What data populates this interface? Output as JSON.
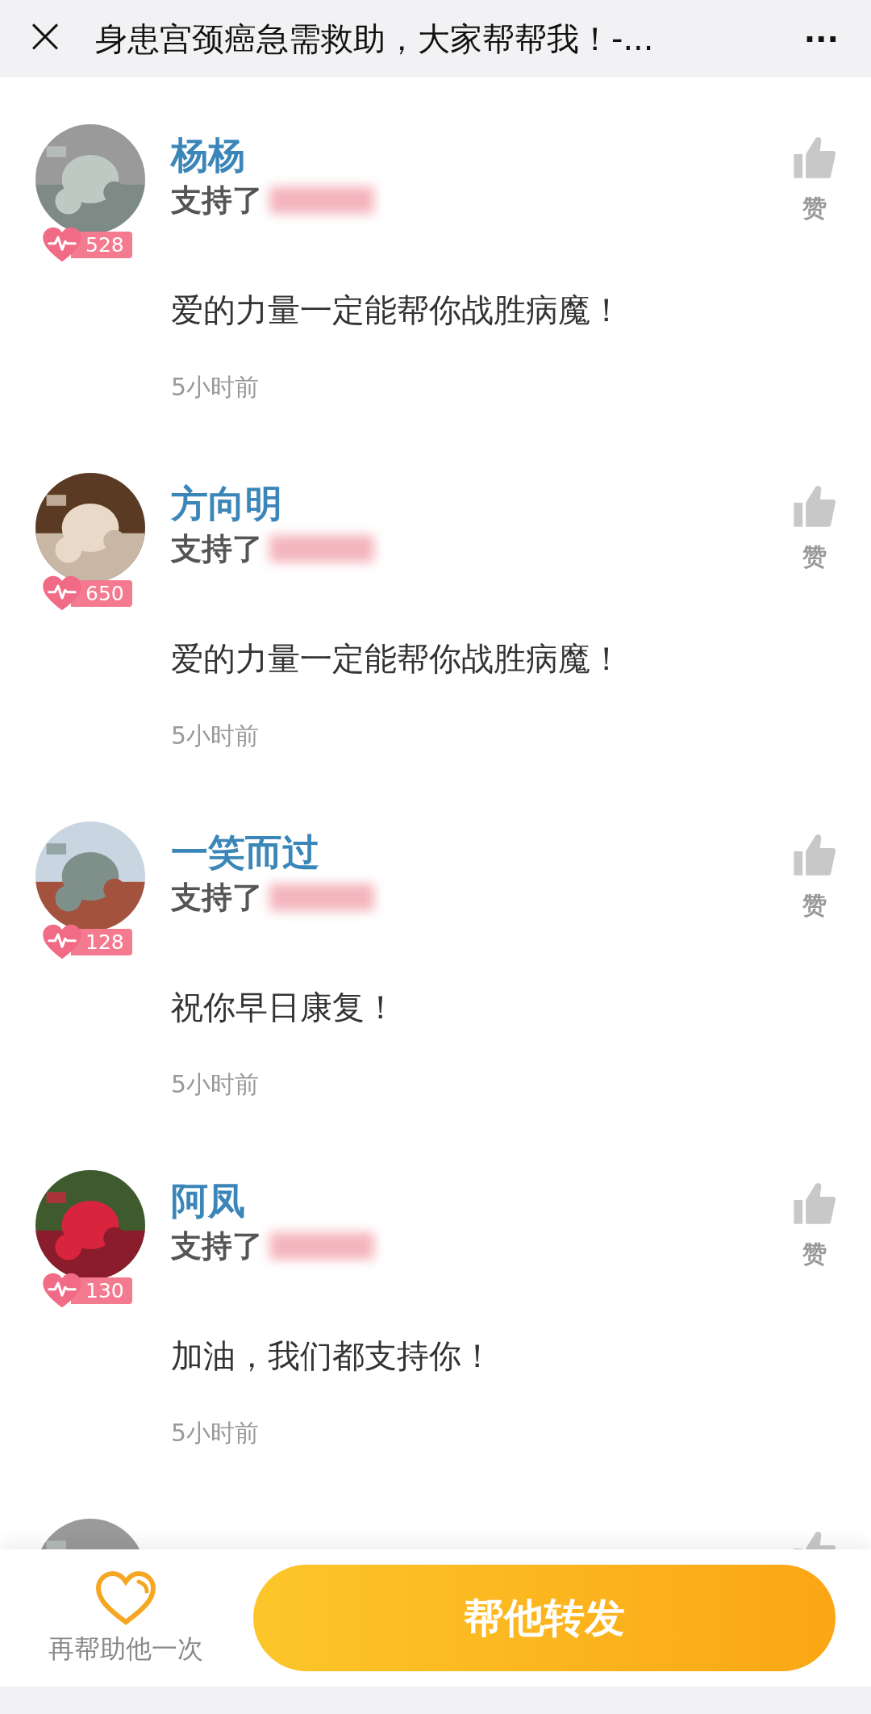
{
  "header": {
    "close": "×",
    "title": "身患宫颈癌急需救助，大家帮帮我！-...",
    "more": "···"
  },
  "comments": [
    {
      "avatar": {
        "kind": "picture"
      },
      "badge": "528",
      "name": "杨杨",
      "supported": "支持了",
      "message": "爱的力量一定能帮你战胜病魔！",
      "time": "5小时前",
      "like": "赞"
    },
    {
      "avatar": {
        "kind": "picture"
      },
      "badge": "650",
      "name": "方向明",
      "supported": "支持了",
      "message": "爱的力量一定能帮你战胜病魔！",
      "time": "5小时前",
      "like": "赞"
    },
    {
      "avatar": {
        "kind": "picture"
      },
      "badge": "128",
      "name": "一笑而过",
      "supported": "支持了",
      "message": "祝你早日康复！",
      "time": "5小时前",
      "like": "赞"
    },
    {
      "avatar": {
        "kind": "picture"
      },
      "badge": "130",
      "name": "阿凤",
      "supported": "支持了",
      "message": "加油，我们都支持你！",
      "time": "5小时前",
      "like": "赞"
    },
    {
      "avatar": {
        "kind": "picture"
      }
    }
  ],
  "footer": {
    "help_again": "再帮助他一次",
    "share_button": "帮他转发"
  }
}
